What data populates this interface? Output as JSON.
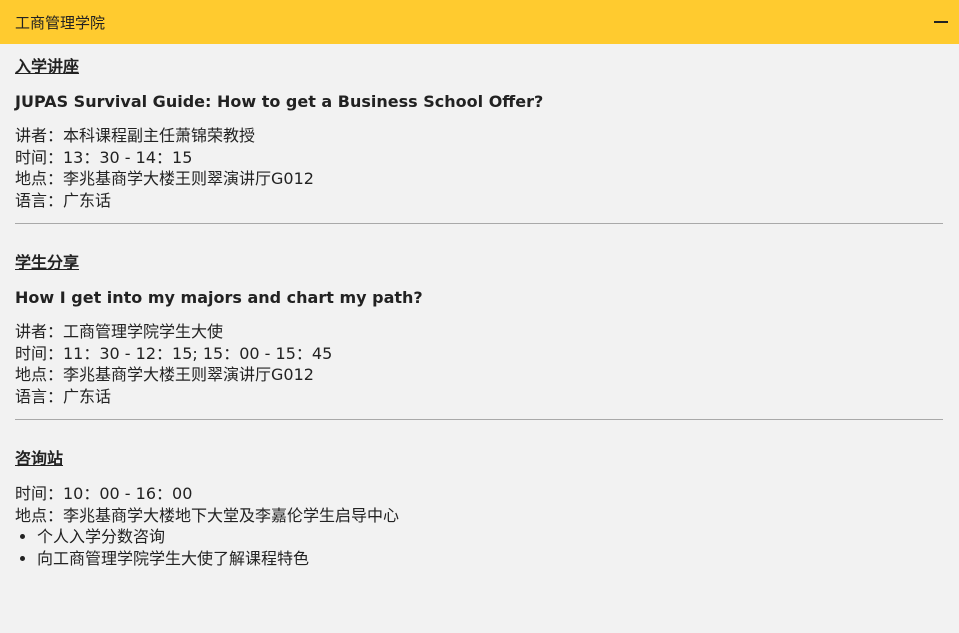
{
  "header": {
    "title": "工商管理学院"
  },
  "sections": [
    {
      "title": "入学讲座",
      "talk_title": "JUPAS Survival Guide: How to get a Business School Offer?",
      "details": [
        "讲者：本科课程副主任萧锦荣教授",
        "时间：13：30 - 14：15",
        "地点：李兆基商学大楼王则翠演讲厅G012",
        "语言：广东话"
      ]
    },
    {
      "title": "学生分享",
      "talk_title": "How I get into my majors and chart my path?",
      "details": [
        "讲者：工商管理学院学生大使",
        "时间：11：30 - 12：15; 15：00 - 15：45",
        "地点：李兆基商学大楼王则翠演讲厅G012",
        "语言：广东话"
      ]
    },
    {
      "title": "咨询站",
      "details": [
        "时间：10：00 - 16：00",
        "地点：李兆基商学大楼地下大堂及李嘉伦学生启导中心"
      ],
      "bullets": [
        "个人入学分数咨询",
        "向工商管理学院学生大使了解课程特色"
      ]
    }
  ]
}
